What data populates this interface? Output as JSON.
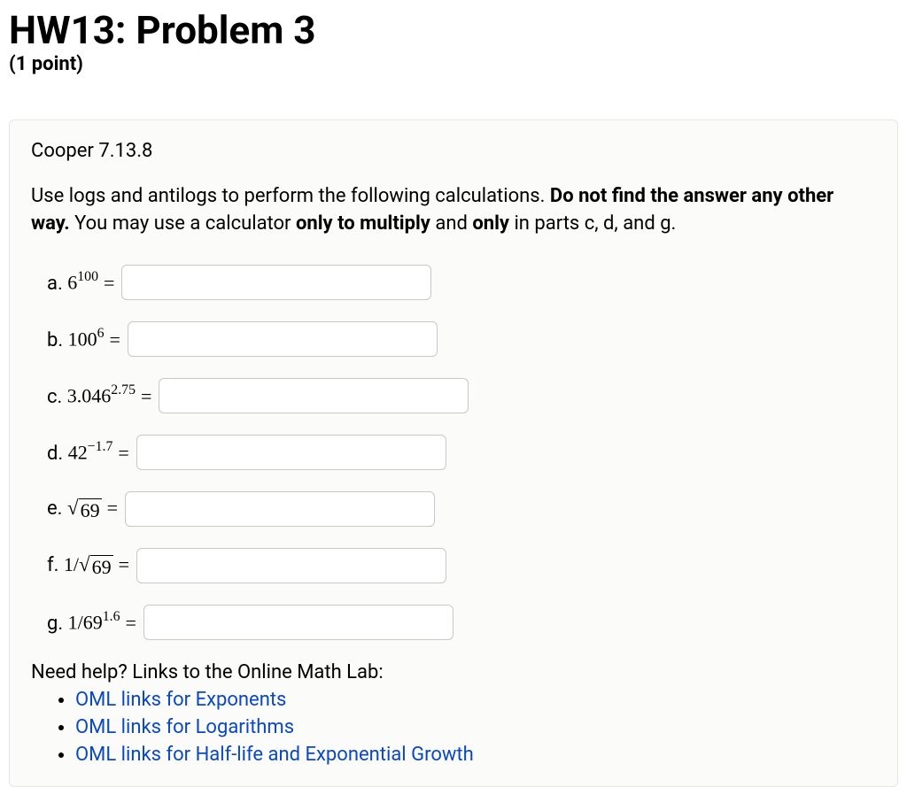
{
  "heading": "HW13: Problem 3",
  "points": "(1 point)",
  "reference": "Cooper 7.13.8",
  "instructions_pre": "Use logs and antilogs to perform the following calculations. ",
  "instructions_bold1": "Do not find the answer any other way.",
  "instructions_mid": " You may use a calculator ",
  "instructions_bold2": "only to multiply",
  "instructions_mid2": " and ",
  "instructions_bold3": "only",
  "instructions_post": " in parts c, d, and g.",
  "problems": {
    "a": {
      "letter": "a.",
      "base": "6",
      "exp": "100"
    },
    "b": {
      "letter": "b.",
      "base": "100",
      "exp": "6"
    },
    "c": {
      "letter": "c.",
      "base": "3.046",
      "exp": "2.75"
    },
    "d": {
      "letter": "d.",
      "base": "42",
      "exp": "−1.7"
    },
    "e": {
      "letter": "e.",
      "radicand": "69"
    },
    "f": {
      "letter": "f.",
      "prefix": "1/",
      "radicand": "69"
    },
    "g": {
      "letter": "g.",
      "prefix": "1/",
      "base": "69",
      "exp": "1.6"
    }
  },
  "equals": "=",
  "help": {
    "header": "Need help? Links to the Online Math Lab:",
    "links": [
      "OML links for Exponents",
      "OML links for Logarithms",
      "OML links for Half-life and Exponential Growth"
    ]
  }
}
